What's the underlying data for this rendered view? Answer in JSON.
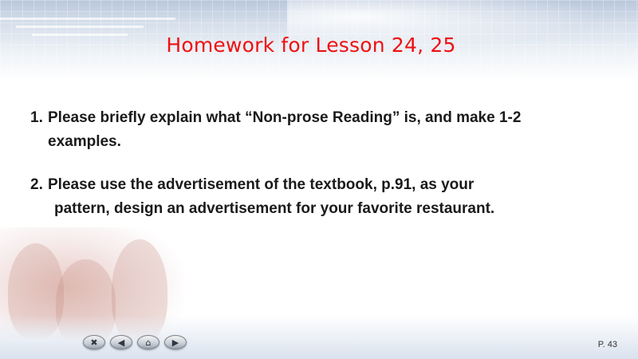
{
  "slide": {
    "title": "Homework for Lesson 24, 25",
    "items": [
      {
        "number": "1.",
        "line1": "Please briefly explain what “Non-prose Reading” is, and make 1-2",
        "line2": "examples."
      },
      {
        "number": "2.",
        "line1": "Please use the advertisement of the textbook, p.91, as your",
        "line2": "pattern, design an advertisement for your favorite restaurant."
      }
    ],
    "page_number": "P. 43"
  },
  "nav": {
    "close_icon": "✖",
    "prev_icon": "◀",
    "home_icon": "⌂",
    "next_icon": "▶"
  },
  "colors": {
    "title": "#ee1111",
    "body_text": "#1a1a1a"
  }
}
